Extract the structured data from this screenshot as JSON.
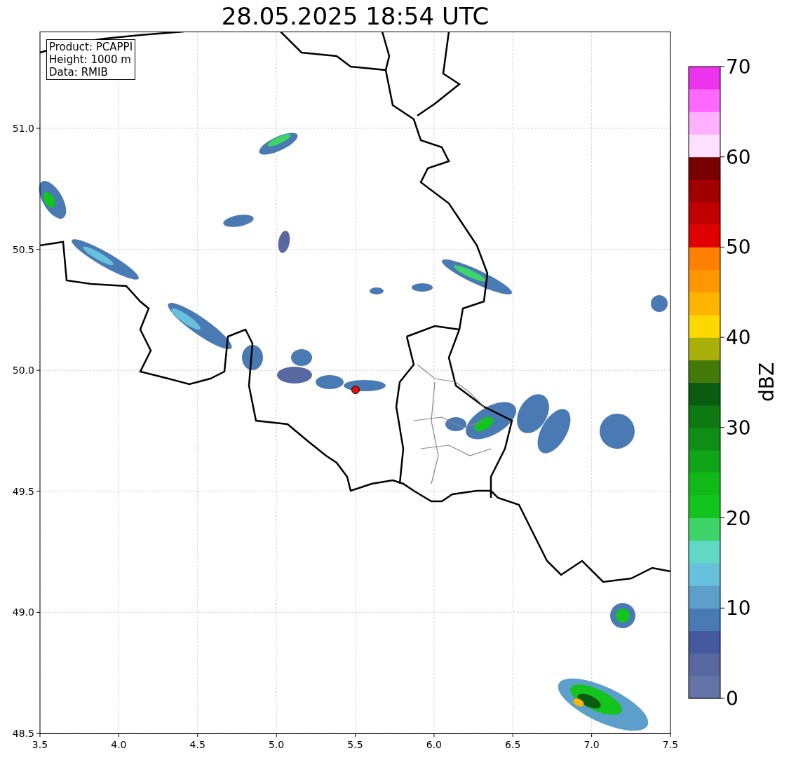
{
  "title": "28.05.2025 18:54 UTC",
  "info_box": [
    "Product: PCAPPI",
    "Height: 1000 m",
    "Data: RMIB"
  ],
  "x_ticks": [
    "3.5",
    "4.0",
    "4.5",
    "5.0",
    "5.5",
    "6.0",
    "6.5",
    "7.0",
    "7.5"
  ],
  "y_ticks": [
    "51.0",
    "50.5",
    "50.0",
    "49.5",
    "49.0",
    "48.5"
  ],
  "colorbar": {
    "label": "dBZ",
    "ticks": [
      "70",
      "60",
      "50",
      "40",
      "30",
      "20",
      "10",
      "0"
    ],
    "segments": [
      {
        "color": "#6474a8"
      },
      {
        "color": "#5868a0"
      },
      {
        "color": "#4459a0"
      },
      {
        "color": "#4a7ab4"
      },
      {
        "color": "#5b9fca"
      },
      {
        "color": "#66c2dc"
      },
      {
        "color": "#60d8c4"
      },
      {
        "color": "#3ed46a"
      },
      {
        "color": "#12c41c"
      },
      {
        "color": "#10b818"
      },
      {
        "color": "#10a418"
      },
      {
        "color": "#0e8e14"
      },
      {
        "color": "#0c7a10"
      },
      {
        "color": "#0a5c0e"
      },
      {
        "color": "#447a0a"
      },
      {
        "color": "#aab00a"
      },
      {
        "color": "#ffd800"
      },
      {
        "color": "#ffb400"
      },
      {
        "color": "#ff9800"
      },
      {
        "color": "#ff8000"
      },
      {
        "color": "#e00000"
      },
      {
        "color": "#c00000"
      },
      {
        "color": "#a00000"
      },
      {
        "color": "#780000"
      },
      {
        "color": "#ffe0ff"
      },
      {
        "color": "#ffb0ff"
      },
      {
        "color": "#ff68ff"
      },
      {
        "color": "#ee33ee"
      }
    ]
  }
}
